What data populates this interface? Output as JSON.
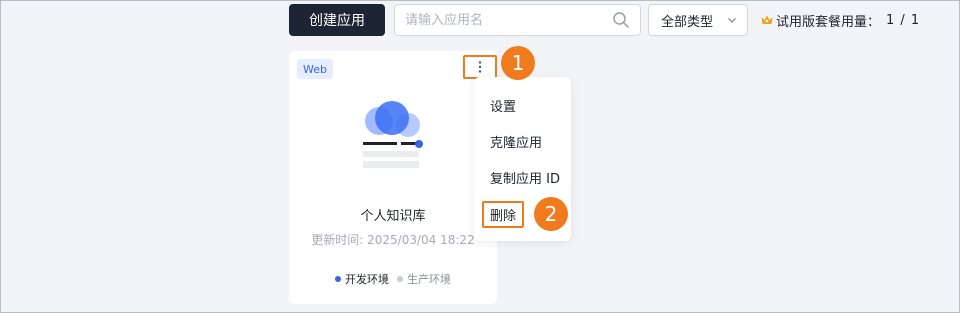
{
  "toolbar": {
    "create_label": "创建应用",
    "search_placeholder": "请输入应用名",
    "type_filter": "全部类型",
    "quota_label": "试用版套餐用量：",
    "quota_value": "1 / 1"
  },
  "card": {
    "tag": "Web",
    "title": "个人知识库",
    "updated": "更新时间: 2025/03/04 18:22",
    "envs": [
      {
        "label": "开发环境",
        "color": "#3366e6"
      },
      {
        "label": "生产环境",
        "color": "#c8cbd1"
      }
    ]
  },
  "menu": {
    "items": [
      "设置",
      "克隆应用",
      "复制应用 ID",
      "删除"
    ]
  },
  "callouts": [
    "1",
    "2"
  ],
  "colors": {
    "accent_orange": "#f07a1e",
    "dark_button": "#1d2433",
    "brand_blue": "#3b63e8"
  }
}
